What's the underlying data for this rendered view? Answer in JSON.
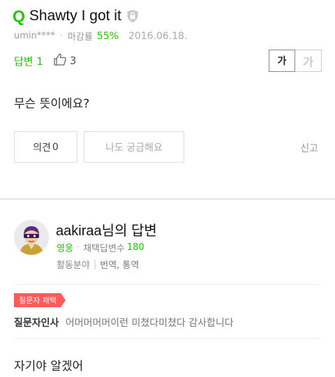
{
  "question": {
    "mark": "Q",
    "title": "Shawty I got it",
    "author": "umin****",
    "rate_label": "마감률",
    "rate_value": "55%",
    "date": "2016.06.18.",
    "answers_label": "답변 1",
    "like_count": "3",
    "body": "무슨 뜻이에요?"
  },
  "font_size": {
    "normal": "가",
    "large": "가"
  },
  "actions": {
    "opinion_label": "의견",
    "opinion_count": "0",
    "curious_label": "나도 궁금해요",
    "report_label": "신고"
  },
  "answer": {
    "title": "aakiraa님의 답변",
    "grade": "영웅",
    "adopted_label": "채택답변수",
    "adopted_count": "180",
    "field_label": "활동분야",
    "field_value": "번역, 통역",
    "badge": "질문자 채택",
    "thanks_label": "질문자인사",
    "thanks_text": "어머머머머이런 미쳤다미쳤다 감사합니다",
    "body": "자기야 알겠어"
  },
  "colors": {
    "accent": "#1ec800",
    "badge": "#ff5a5a"
  },
  "icons": [
    "lock-shield-icon",
    "thumbs-up-icon",
    "avatar-icon"
  ]
}
